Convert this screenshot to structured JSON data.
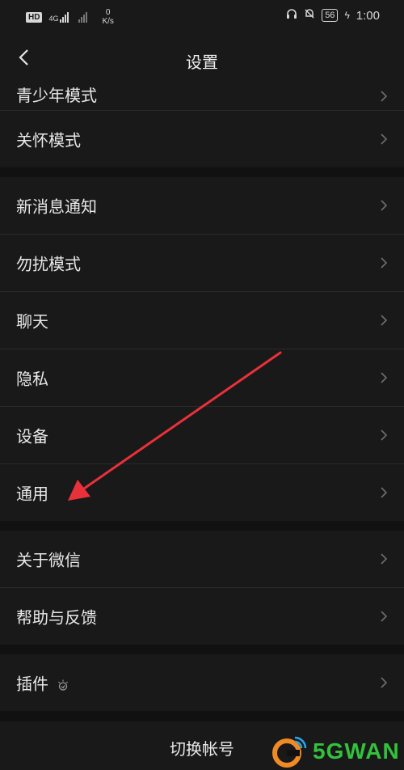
{
  "status_bar": {
    "hd": "HD",
    "signal": "4G",
    "speed_value": "0",
    "speed_unit": "K/s",
    "battery": "56",
    "time": "1:00"
  },
  "header": {
    "title": "设置"
  },
  "sections": [
    {
      "items": [
        {
          "label": "青少年模式"
        },
        {
          "label": "关怀模式"
        }
      ]
    },
    {
      "items": [
        {
          "label": "新消息通知"
        },
        {
          "label": "勿扰模式"
        },
        {
          "label": "聊天"
        },
        {
          "label": "隐私"
        },
        {
          "label": "设备"
        },
        {
          "label": "通用"
        }
      ]
    },
    {
      "items": [
        {
          "label": "关于微信"
        },
        {
          "label": "帮助与反馈"
        }
      ]
    },
    {
      "items": [
        {
          "label": "插件"
        }
      ]
    }
  ],
  "bottom": {
    "switch_account": "切换帐号"
  },
  "watermark": {
    "text": "5GWAN"
  },
  "colors": {
    "background": "#111111",
    "surface": "#191919",
    "annotation_arrow": "#e8313a",
    "watermark": "#32c23b"
  }
}
